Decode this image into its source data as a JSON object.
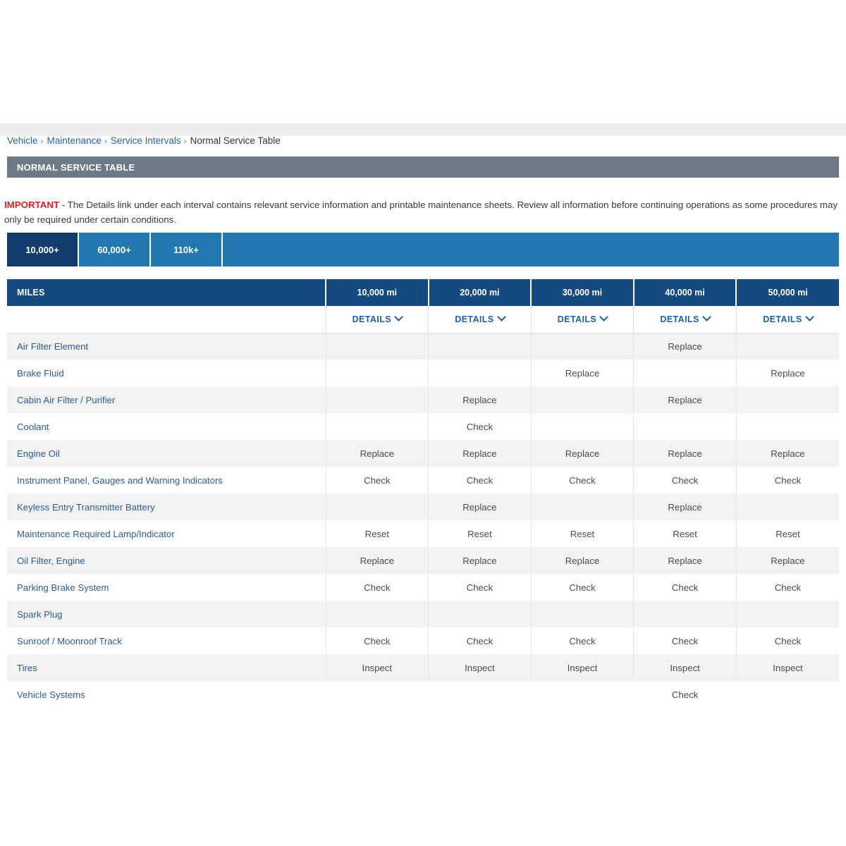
{
  "breadcrumb": {
    "items": [
      {
        "label": "Vehicle",
        "current": false
      },
      {
        "label": "Maintenance",
        "current": false
      },
      {
        "label": "Service Intervals",
        "current": false
      },
      {
        "label": "Normal Service Table",
        "current": true
      }
    ],
    "separator": "›"
  },
  "section": {
    "title": "NORMAL SERVICE TABLE"
  },
  "notice": {
    "label": "IMPORTANT",
    "text": " - The Details link under each interval contains relevant service information and printable maintenance sheets. Review all information before continuing operations as some procedures may only be required under certain conditions."
  },
  "tabs": [
    {
      "label": "10,000+",
      "active": true
    },
    {
      "label": "60,000+",
      "active": false
    },
    {
      "label": "110k+",
      "active": false
    }
  ],
  "table": {
    "label_header": "MILES",
    "interval_headers": [
      "10,000 mi",
      "20,000 mi",
      "30,000 mi",
      "40,000 mi",
      "50,000 mi"
    ],
    "details_label": "DETAILS",
    "rows": [
      {
        "label": "Air Filter Element",
        "values": [
          "",
          "",
          "",
          "Replace",
          ""
        ]
      },
      {
        "label": "Brake Fluid",
        "values": [
          "",
          "",
          "Replace",
          "",
          "Replace"
        ]
      },
      {
        "label": "Cabin Air Filter / Purifier",
        "values": [
          "",
          "Replace",
          "",
          "Replace",
          ""
        ]
      },
      {
        "label": "Coolant",
        "values": [
          "",
          "Check",
          "",
          "",
          ""
        ]
      },
      {
        "label": "Engine Oil",
        "values": [
          "Replace",
          "Replace",
          "Replace",
          "Replace",
          "Replace"
        ]
      },
      {
        "label": "Instrument Panel, Gauges and Warning Indicators",
        "values": [
          "Check",
          "Check",
          "Check",
          "Check",
          "Check"
        ]
      },
      {
        "label": "Keyless Entry Transmitter Battery",
        "values": [
          "",
          "Replace",
          "",
          "Replace",
          ""
        ]
      },
      {
        "label": "Maintenance Required Lamp/Indicator",
        "values": [
          "Reset",
          "Reset",
          "Reset",
          "Reset",
          "Reset"
        ]
      },
      {
        "label": "Oil Filter, Engine",
        "values": [
          "Replace",
          "Replace",
          "Replace",
          "Replace",
          "Replace"
        ]
      },
      {
        "label": "Parking Brake System",
        "values": [
          "Check",
          "Check",
          "Check",
          "Check",
          "Check"
        ]
      },
      {
        "label": "Spark Plug",
        "values": [
          "",
          "",
          "",
          "",
          ""
        ]
      },
      {
        "label": "Sunroof / Moonroof Track",
        "values": [
          "Check",
          "Check",
          "Check",
          "Check",
          "Check"
        ]
      },
      {
        "label": "Tires",
        "values": [
          "Inspect",
          "Inspect",
          "Inspect",
          "Inspect",
          "Inspect"
        ]
      },
      {
        "label": "Vehicle Systems",
        "values": [
          "",
          "",
          "",
          "Check",
          ""
        ]
      }
    ]
  },
  "colors": {
    "header_navy": "#154a80",
    "tab_active": "#123c6b",
    "tab_blue": "#2378b0",
    "section_gray": "#6d7985",
    "important_red": "#d8232a",
    "link_blue": "#2d5b96",
    "row_stripe": "#f2f2f2"
  }
}
